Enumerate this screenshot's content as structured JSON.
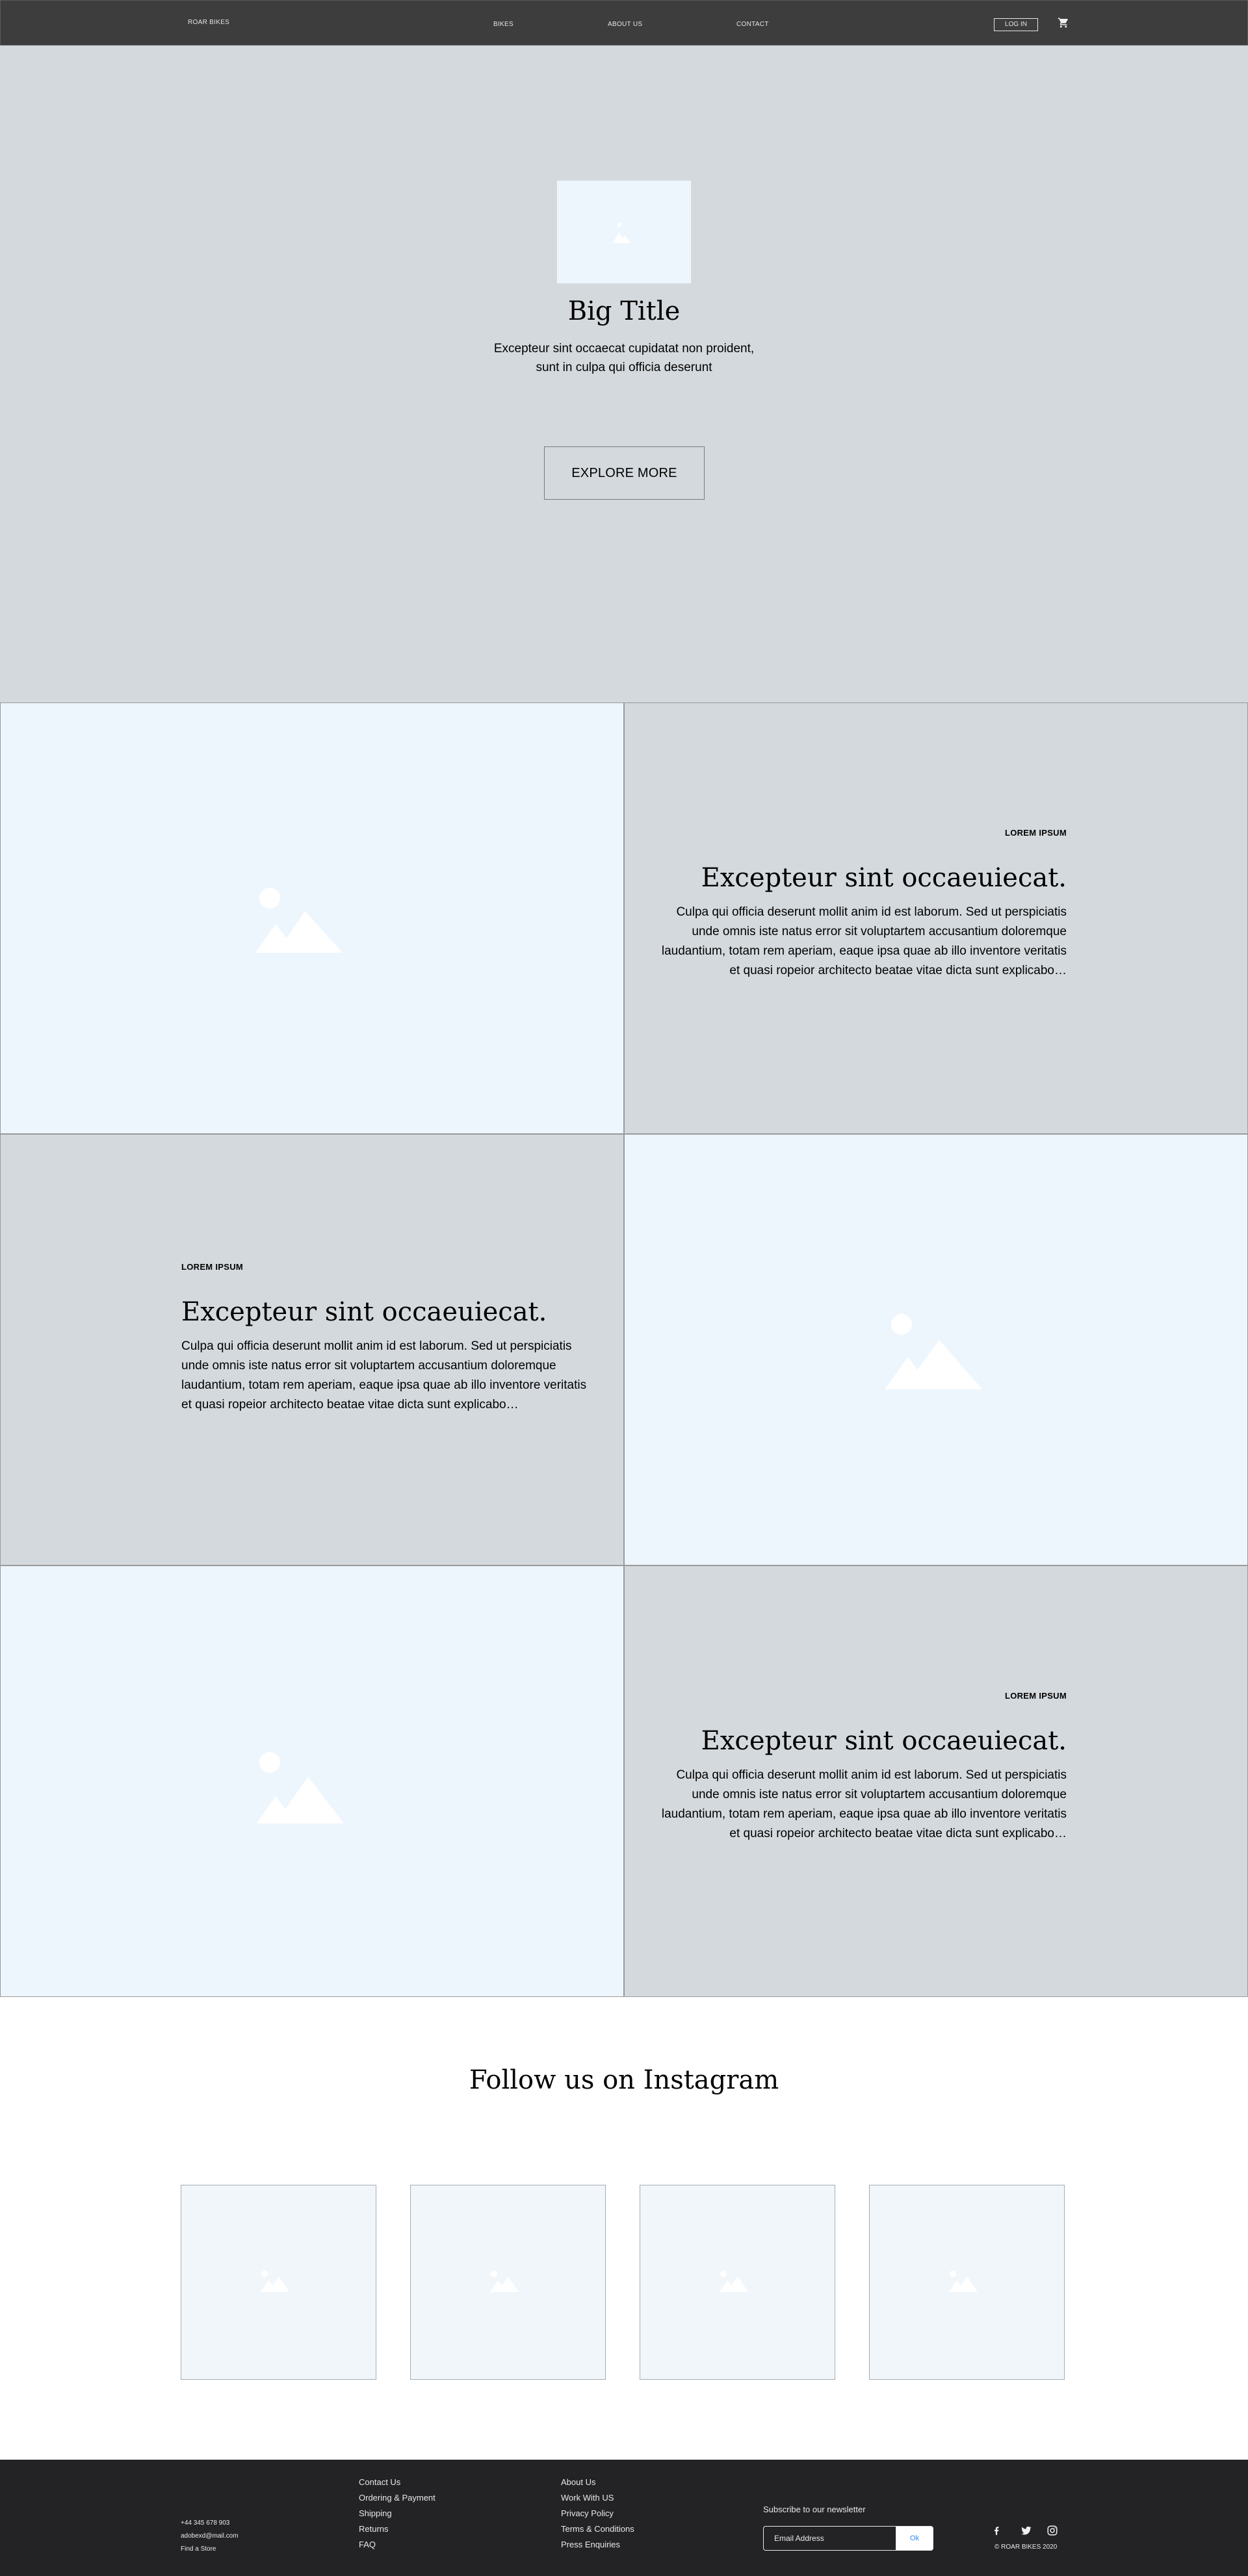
{
  "nav": {
    "brand": "ROAR BIKES",
    "links": [
      "BIKES",
      "ABOUT US",
      "CONTACT"
    ],
    "login": "LOG IN",
    "cart_icon": "cart-icon"
  },
  "hero": {
    "title": "Big Title",
    "subtitle": "Excepteur sint occaecat cupidatat non proident, sunt in culpa qui officia deserunt",
    "cta": "EXPLORE MORE"
  },
  "features": [
    {
      "kicker": "LOREM IPSUM",
      "heading": "Excepteur sint occaeuiecat.",
      "body": "Culpa qui officia deserunt mollit anim id est laborum. Sed ut perspiciatis unde omnis iste natus error sit voluptartem accusantium doloremque laudantium, totam rem aperiam, eaque ipsa quae ab illo inventore veritatis et quasi ropeior architecto beatae vitae dicta sunt explicabo…"
    },
    {
      "kicker": "LOREM IPSUM",
      "heading": "Excepteur sint occaeuiecat.",
      "body": "Culpa qui officia deserunt mollit anim id est laborum. Sed ut perspiciatis unde omnis iste natus error sit voluptartem accusantium doloremque laudantium, totam rem aperiam, eaque ipsa quae ab illo inventore veritatis et quasi ropeior architecto beatae vitae dicta sunt explicabo…"
    },
    {
      "kicker": "LOREM IPSUM",
      "heading": "Excepteur sint occaeuiecat.",
      "body": "Culpa qui officia deserunt mollit anim id est laborum. Sed ut perspiciatis unde omnis iste natus error sit voluptartem accusantium doloremque laudantium, totam rem aperiam, eaque ipsa quae ab illo inventore veritatis et quasi ropeior architecto beatae vitae dicta sunt explicabo…"
    }
  ],
  "instagram": {
    "title": "Follow us on Instagram"
  },
  "footer": {
    "contact": [
      "+44 345 678 903",
      "adobexd@mail.com",
      "Find a Store"
    ],
    "col1": [
      "Contact Us",
      "Ordering & Payment",
      "Shipping",
      "Returns",
      "FAQ"
    ],
    "col2": [
      "About Us",
      "Work With US",
      "Privacy Policy",
      "Terms & Conditions",
      "Press Enquiries"
    ],
    "newsletter_label": "Subscribe to our newsletter",
    "email_placeholder": "Email Address",
    "submit": "Ok",
    "social_icons": [
      "facebook-icon",
      "twitter-icon",
      "instagram-icon"
    ],
    "copyright": "© ROAR BIKES 2020"
  },
  "colors": {
    "nav_bg": "#3d3d3d",
    "section_gray": "#d4d9dd",
    "placeholder_blue": "#eef6fd",
    "footer_bg": "#232325",
    "accent": "#2f86ff"
  }
}
